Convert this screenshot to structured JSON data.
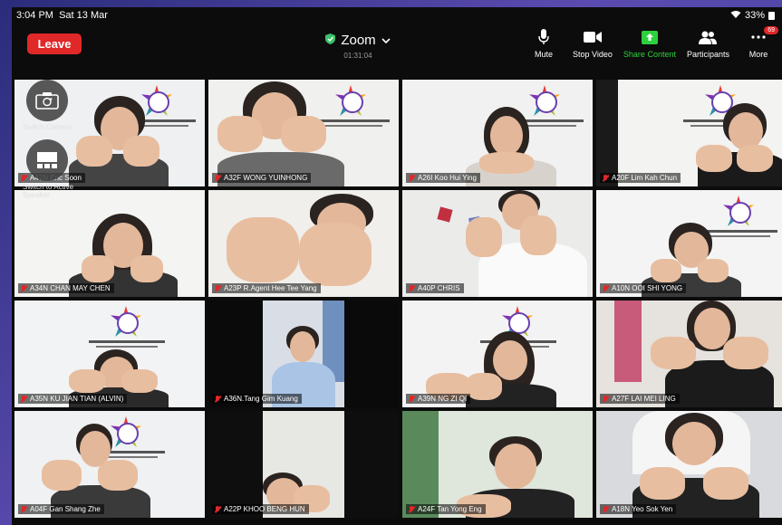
{
  "status": {
    "time": "3:04 PM",
    "date": "Sat 13 Mar",
    "battery": "33%"
  },
  "meeting": {
    "title": "Zoom",
    "timer": "01:31:04"
  },
  "leave_label": "Leave",
  "toolbar": {
    "mute": "Mute",
    "stop_video": "Stop Video",
    "share_content": "Share Content",
    "participants": "Participants",
    "more": "More",
    "participant_count": "69"
  },
  "overlay": {
    "switch_camera": "Switch Camera",
    "switch_active_speaker": "Switch to Active Speaker"
  },
  "participants": [
    "A47N Eric Soon",
    "A32F WONG YUINHONG",
    "A26I Koo Hui Ying",
    "A20F Lim Kah Chun",
    "A34N CHAN MAY CHEN",
    "A23P R.Agent Hee Tee Yang",
    "A40P CHRIS",
    "A10N OOI SHI YONG",
    "A35N KU JIAN TIAN (ALVIN)",
    "A36N.Tang Gim Kuang",
    "A39N NG ZI QI",
    "A27F LAI MEI LING",
    "A04F Gan Shang Zhe",
    "A22P KHOO BENG HUN",
    "A24F Tan Yong Eng",
    "A18N Yeo Sok Yen"
  ],
  "colors": {
    "leave": "#e02828",
    "share": "#2ed13d",
    "shield": "#3ac16b"
  }
}
